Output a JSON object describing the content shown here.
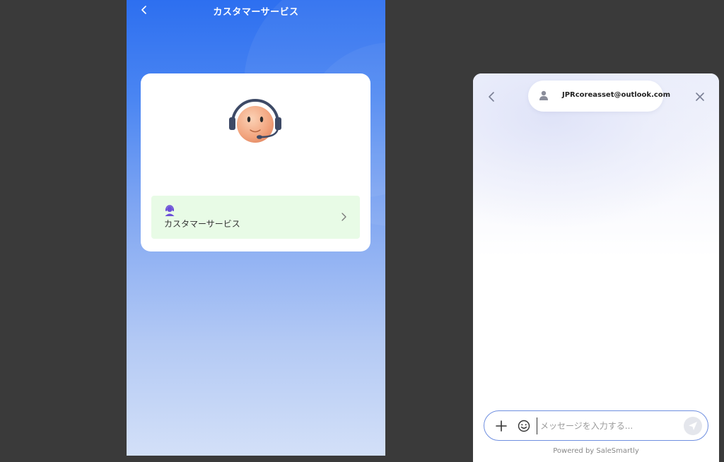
{
  "phone": {
    "title": "カスタマーサービス",
    "service_item": {
      "label": "カスタマーサービス"
    }
  },
  "chat": {
    "agent_email": "JPRcoreasset@outlook.com",
    "input_placeholder": "メッセージを入力する...",
    "powered_by": "Powered by SaleSmartly"
  },
  "icons": {
    "phone_back": "chevron-left-icon",
    "avatar": "headset-agent-avatar",
    "service": "support-agent-icon",
    "service_chevron": "chevron-right-icon",
    "chat_back": "chevron-left-icon",
    "chat_close": "close-icon",
    "agent": "user-icon",
    "plus": "plus-icon",
    "emoji": "emoji-icon",
    "send": "send-icon"
  },
  "colors": {
    "phone_gradient_top": "#2d6ff0",
    "phone_gradient_bottom": "#d3e0f8",
    "service_row_bg": "#e8fbe6",
    "composer_border": "#6f8fe0",
    "service_icon": "#6b4fd8"
  }
}
